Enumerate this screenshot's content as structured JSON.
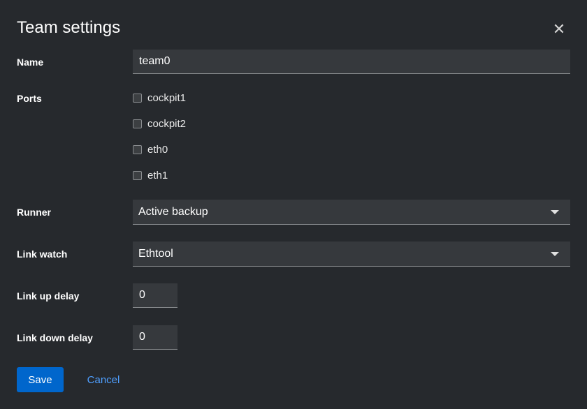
{
  "dialog": {
    "title": "Team settings",
    "close_icon": "close-icon"
  },
  "form": {
    "name": {
      "label": "Name",
      "value": "team0"
    },
    "ports": {
      "label": "Ports",
      "items": [
        {
          "label": "cockpit1",
          "checked": false
        },
        {
          "label": "cockpit2",
          "checked": false
        },
        {
          "label": "eth0",
          "checked": false
        },
        {
          "label": "eth1",
          "checked": false
        }
      ]
    },
    "runner": {
      "label": "Runner",
      "value": "Active backup"
    },
    "link_watch": {
      "label": "Link watch",
      "value": "Ethtool"
    },
    "link_up_delay": {
      "label": "Link up delay",
      "value": "0"
    },
    "link_down_delay": {
      "label": "Link down delay",
      "value": "0"
    }
  },
  "actions": {
    "save_label": "Save",
    "cancel_label": "Cancel"
  },
  "colors": {
    "background": "#26292d",
    "input_background": "#36393d",
    "primary": "#0066cc",
    "link": "#4f9fff"
  }
}
